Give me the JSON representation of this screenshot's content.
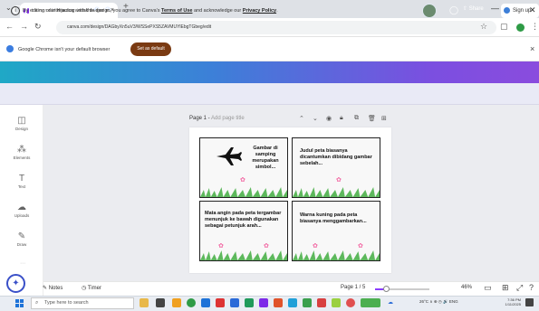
{
  "browser": {
    "tab_title": "Salinan dari Hijau dan kotak dengan e...",
    "tab_close": "×",
    "new_tab": "+",
    "url": "canva.com/design/DAGbyXn5uV3/WSSePXS5ZAVMUYlEbgTGbeg/edit",
    "window_controls": [
      "—",
      "▭",
      "✕"
    ]
  },
  "infobar": {
    "message": "Google Chrome isn't your default browser",
    "button": "Set as default",
    "close": "×"
  },
  "canva_header": {
    "logo": "Canva",
    "file_menu": "File",
    "share": "Share",
    "signup": "Sign up"
  },
  "terms_bar": {
    "prefix": "By editing or interacting with this design, you agree to Canva's",
    "terms_link": "Terms of Use",
    "middle": "and acknowledge our",
    "privacy_link": "Privacy Policy",
    "suffix": "."
  },
  "sidebar": {
    "items": [
      {
        "label": "Design",
        "icon": "design-icon"
      },
      {
        "label": "Elements",
        "icon": "elements-icon"
      },
      {
        "label": "Text",
        "icon": "text-icon"
      },
      {
        "label": "Uploads",
        "icon": "uploads-icon"
      },
      {
        "label": "Draw",
        "icon": "draw-icon"
      }
    ]
  },
  "page": {
    "title_prefix": "Page 1 -",
    "title_placeholder": "Add page title"
  },
  "cards": [
    {
      "text": "Gambar di samping merupakan simbol..."
    },
    {
      "text": "Judul peta biasanya dicantumkan dibidang gambar sebelah..."
    },
    {
      "text": "Mata angin pada peta tergambar menunjuk ke bawah digunakan sebagai petunjuk arah..."
    },
    {
      "text": "Warna kuning pada peta biasanya menggambarkan..."
    }
  ],
  "bottom_bar": {
    "notes": "Notes",
    "timer": "Timer",
    "page_indicator": "Page 1 / 5",
    "zoom": "46%",
    "zoom_fraction": 0.2
  },
  "taskbar": {
    "search_placeholder": "Type here to search",
    "tray": "26°C  ∧  ⊕ ◷ 🔊 ENG",
    "clock_time": "7:36 PM",
    "clock_date": "1/11/2025"
  },
  "colors": {
    "canva_purple": "#8b3dff",
    "set_default_brown": "#7a3a12",
    "flower_pink": "#f26ba5",
    "grass_green": "#5db85c"
  }
}
